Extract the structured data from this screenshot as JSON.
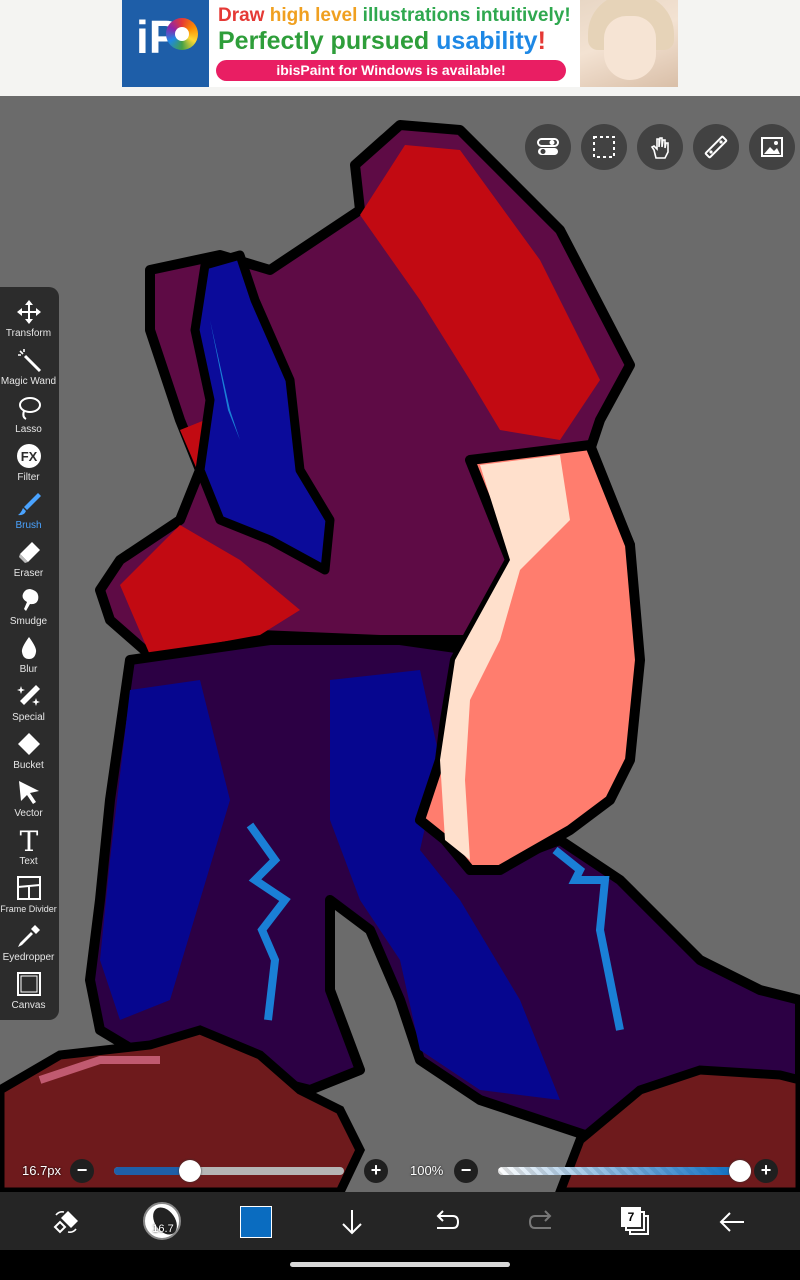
{
  "ad": {
    "line1_a": "Draw ",
    "line1_b": "high level ",
    "line1_c": "illustrations intuitively!",
    "line2_a": "Perfectly pursued ",
    "line2_b": "usability",
    "line2_c": "!",
    "pill": "ibisPaint for Windows is available!",
    "logo_text": "iP"
  },
  "top_tools": [
    {
      "icon": "toggle-icon"
    },
    {
      "icon": "selection-icon"
    },
    {
      "icon": "hand-icon"
    },
    {
      "icon": "ruler-icon"
    },
    {
      "icon": "reference-image-icon"
    }
  ],
  "toolbar": {
    "active": "Brush",
    "tools": [
      {
        "label": "Transform",
        "icon": "move-icon"
      },
      {
        "label": "Magic Wand",
        "icon": "magic-wand-icon"
      },
      {
        "label": "Lasso",
        "icon": "lasso-icon"
      },
      {
        "label": "Filter",
        "icon": "fx-icon"
      },
      {
        "label": "Brush",
        "icon": "brush-icon"
      },
      {
        "label": "Eraser",
        "icon": "eraser-icon"
      },
      {
        "label": "Smudge",
        "icon": "smudge-icon"
      },
      {
        "label": "Blur",
        "icon": "blur-drop-icon"
      },
      {
        "label": "Special",
        "icon": "sparkle-pen-icon"
      },
      {
        "label": "Bucket",
        "icon": "bucket-icon"
      },
      {
        "label": "Vector",
        "icon": "arrow-cursor-icon"
      },
      {
        "label": "Text",
        "icon": "text-t-icon"
      },
      {
        "label": "Frame Divider",
        "icon": "frame-divider-icon"
      },
      {
        "label": "Eyedropper",
        "icon": "eyedropper-icon"
      },
      {
        "label": "Canvas",
        "icon": "canvas-icon"
      }
    ]
  },
  "sliders": {
    "size_label": "16.7px",
    "size_fraction": 0.33,
    "opacity_label": "100%",
    "opacity_fraction": 1.0
  },
  "bottom_bar": {
    "brush_size_value": "16.7",
    "layer_count": "7",
    "current_color": "#0a6cc0"
  }
}
